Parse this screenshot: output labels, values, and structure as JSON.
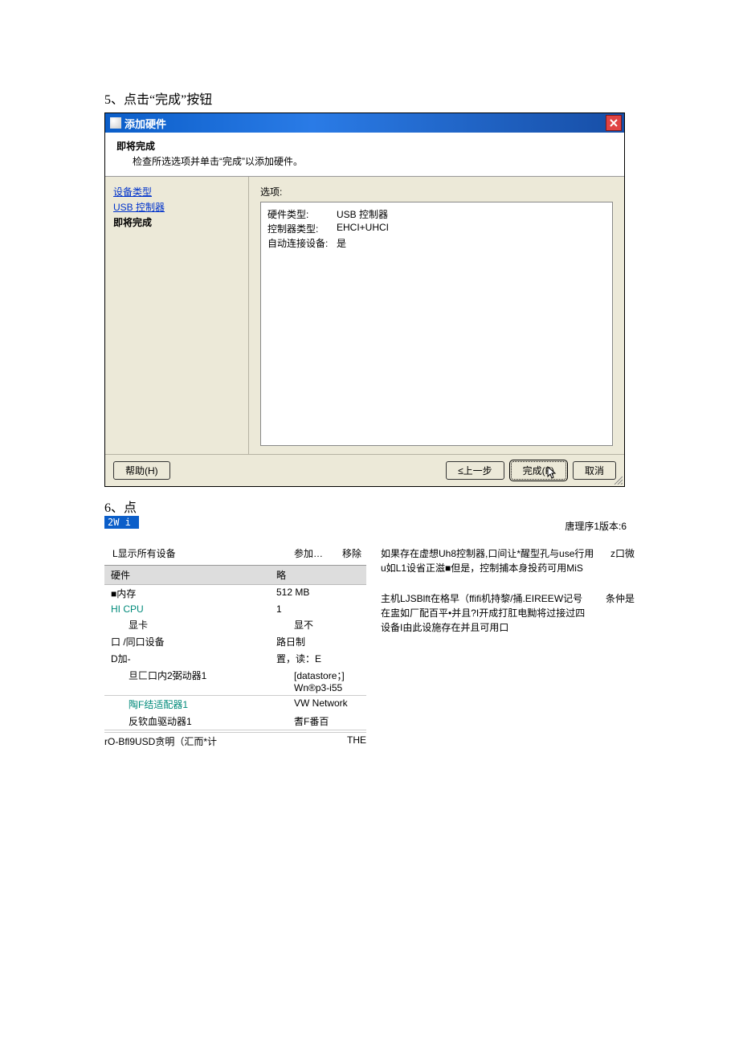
{
  "steps": {
    "s5": "5、点击“完成”按钮",
    "s6": "6、点"
  },
  "dialog": {
    "title": "添加硬件",
    "header_title": "即将完成",
    "header_sub": "检查所选选项并单击“完成”以添加硬件。",
    "nav": {
      "link_devtype": "设备类型",
      "link_usb": "USB 控制器",
      "current": "即将完成"
    },
    "options_label": "选项:",
    "options": [
      {
        "k": "硬件类型:",
        "v": "USB 控制器"
      },
      {
        "k": "控制器类型:",
        "v": "EHCI+UHCI"
      },
      {
        "k": "自动连接设备:",
        "v": "是"
      }
    ],
    "buttons": {
      "help": "帮助(H)",
      "back": "≤上一步",
      "finish": "完成(F)",
      "cancel": "取消"
    }
  },
  "lower": {
    "tab": "2W i",
    "version": "唐理序1版本:6",
    "show_all": "L显示所有设备",
    "actions": {
      "add": "参加…",
      "remove": "移除"
    },
    "table_header": {
      "c1": "硬件",
      "c2": "略"
    },
    "rows": [
      {
        "c1": "■内存",
        "c2": "512 MB",
        "cls": ""
      },
      {
        "c1": "HI CPU",
        "c2": "1",
        "cls": "teal"
      },
      {
        "c1": "显卡",
        "c2": "显不",
        "cls": "indent"
      },
      {
        "c1": "口 /同口设备",
        "c2": "路日制",
        "cls": ""
      },
      {
        "c1": "D加-",
        "c2": "置，读：E",
        "cls": ""
      },
      {
        "c1": "旦匚口内2弼动器1",
        "c2": "[datastore；] Wn®p3-i55",
        "cls": "bordered"
      },
      {
        "c1": "陶F结适配器1",
        "c2": "VW Network",
        "cls": "teal"
      },
      {
        "c1": "反钦血驱动器1",
        "c2": "耆F番百",
        "cls": "bordered"
      }
    ],
    "footer": {
      "c1": "rO-Bfl9USD贪明（汇而*计",
      "c2": "THE"
    },
    "paragraphs": [
      {
        "body": "如果存在虚想Uh8控制器,口间让*醒型孔与use行用u如L1设省正滋■但是，控制捕本身投药可用MiS",
        "tag": "z口微"
      },
      {
        "body": "主机LJSBlft在格早（ffifi机持黎/捅.EIREEW记号在盅如厂配百平•并且?I开成打肛电黝将过接过四设备I由此设施存在并且可用口",
        "tag": "条仲是"
      }
    ]
  }
}
